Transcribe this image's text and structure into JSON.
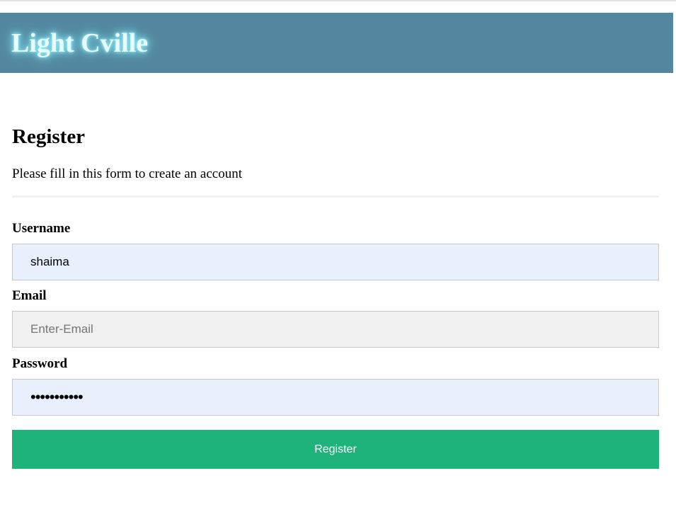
{
  "header": {
    "site_title": "Light Cville"
  },
  "form": {
    "title": "Register",
    "subtitle": "Please fill in this form to create an account",
    "fields": [
      {
        "label": "Username",
        "value": "shaima",
        "placeholder": ""
      },
      {
        "label": "Email",
        "value": "",
        "placeholder": "Enter-Email"
      },
      {
        "label": "Password",
        "value": "•••••••••••",
        "placeholder": ""
      }
    ],
    "submit_label": "Register"
  },
  "colors": {
    "header_bg": "#53879f",
    "title_glow": "#8ef0ff",
    "autofill_bg": "#e8f0fd",
    "empty_input_bg": "#f0f0f0",
    "button_bg": "#1eb37a"
  }
}
